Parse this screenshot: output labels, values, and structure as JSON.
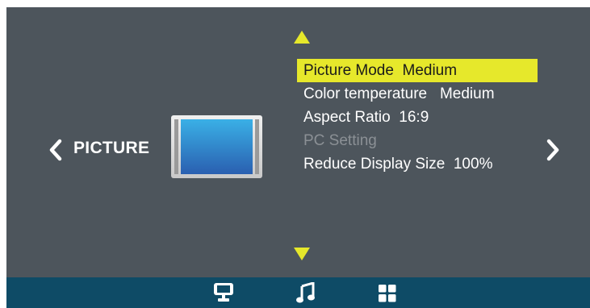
{
  "osd": {
    "category_label": "PICTURE",
    "menu_items": [
      {
        "text": "Picture Mode  Medium",
        "state": "selected"
      },
      {
        "text": "Color temperature   Medium",
        "state": "normal"
      },
      {
        "text": "Aspect Ratio  16:9",
        "state": "normal"
      },
      {
        "text": "PC Setting",
        "state": "disabled"
      },
      {
        "text": "Reduce Display Size  100%",
        "state": "normal"
      }
    ],
    "icons": {
      "category_preview": "monitor-icon",
      "scroll_up": "triangle-up-icon",
      "scroll_down": "triangle-down-icon",
      "prev_category": "chevron-left-icon",
      "next_category": "chevron-right-icon"
    }
  },
  "bottom_bar": {
    "tabs": [
      {
        "icon": "picture-tab-icon",
        "active": true
      },
      {
        "icon": "music-note-icon",
        "active": false
      },
      {
        "icon": "grid-icon",
        "active": false
      }
    ]
  },
  "colors": {
    "background": "#4d555c",
    "highlight": "#e6e82b",
    "bottom_bar": "#0e4b66",
    "text": "#ffffff",
    "disabled_text": "#8b9095",
    "arrow_accent": "#e6e82b"
  }
}
